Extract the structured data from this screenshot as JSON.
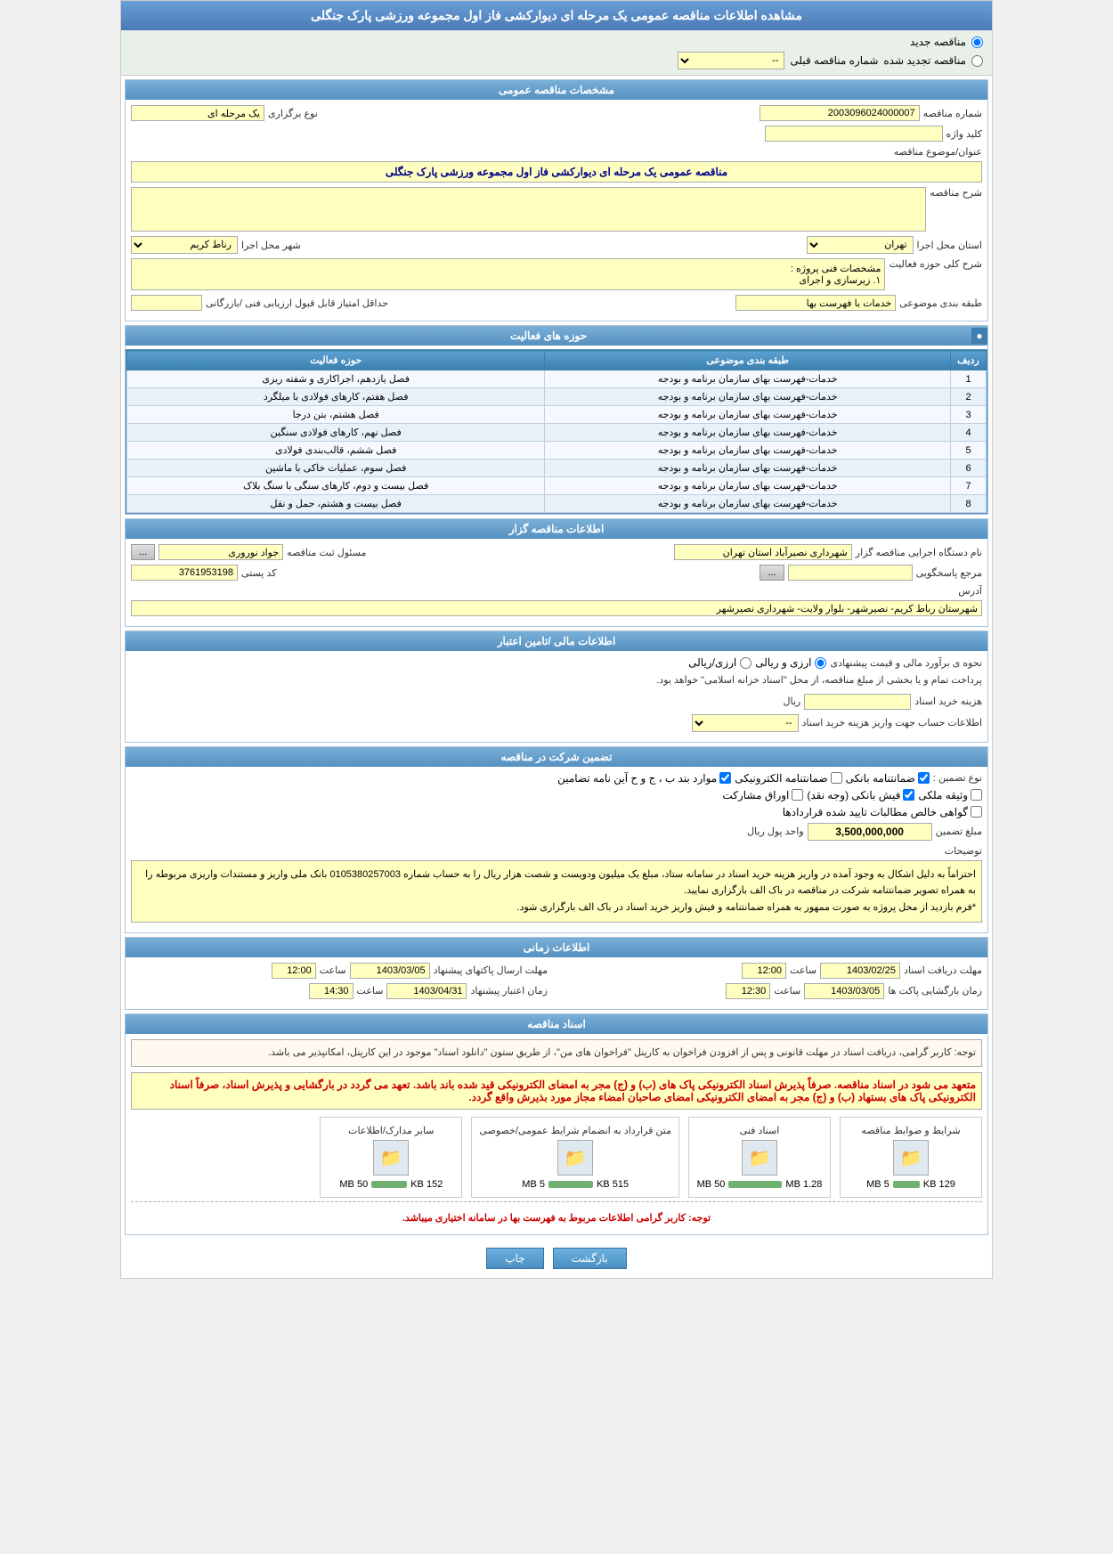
{
  "page": {
    "title": "مشاهده اطلاعات مناقصه عمومی یک مرحله ای دیوارکشی فاز اول مجموعه ورزشی پارک جنگلی"
  },
  "radio": {
    "new_tender": "مناقصه جدید",
    "renewed_tender": "مناقصه تجدید شده",
    "prev_number_label": "شماره مناقصه قبلی"
  },
  "general_specs": {
    "section_title": "مشخصات مناقصه عمومی",
    "tender_number_label": "شماره مناقصه",
    "tender_number_value": "2003096024000007",
    "holding_type_label": "نوع برگزاری",
    "holding_type_value": "یک مرحله ای",
    "keyword_label": "کلید واژه",
    "subject_label": "عنوان/موضوع مناقصه",
    "subject_value": "مناقصه عمومی یک مرحله ای دیوارکشی فاز اول مجموعه ورزشی پارک جنگلی",
    "description_label": "شرح مناقصه",
    "province_label": "استان محل اجرا",
    "province_value": "تهران",
    "city_label": "شهر محل اجرا",
    "city_value": "رناط کریم",
    "activity_scope_label": "شرح کلی حوزه فعالیت",
    "activity_scope_note": "مشخصات فنی پروژه :",
    "activity_scope_sub": "۱.  زیرسازی و اجرای",
    "category_label": "طبقه بندی موضوعی",
    "category_value": "خدمات با فهرست بها",
    "min_score_label": "حداقل امتیاز قابل قبول ارزیابی فنی /بازرگانی"
  },
  "activity_table": {
    "section_title": "حوزه های فعالیت",
    "expand_btn": "●",
    "headers": [
      "ردیف",
      "طبقه بندی موضوعی",
      "حوزه فعالیت"
    ],
    "rows": [
      {
        "row": "1",
        "category": "خدمات-فهرست بهای سازمان برنامه و بودجه",
        "activity": "فصل یازدهم، اجراکاری و شفته ریزی"
      },
      {
        "row": "2",
        "category": "خدمات-فهرست بهای سازمان برنامه و بودجه",
        "activity": "فصل هفتم، کارهای فولادی با میلگرد"
      },
      {
        "row": "3",
        "category": "خدمات-فهرست بهای سازمان برنامه و بودجه",
        "activity": "فصل هشتم، بتن درجا"
      },
      {
        "row": "4",
        "category": "خدمات-فهرست بهای سازمان برنامه و بودجه",
        "activity": "فصل نهم، کارهای فولادی سنگین"
      },
      {
        "row": "5",
        "category": "خدمات-فهرست بهای سازمان برنامه و بودجه",
        "activity": "فصل ششم، قالب‌بندی فولادی"
      },
      {
        "row": "6",
        "category": "خدمات-فهرست بهای سازمان برنامه و بودجه",
        "activity": "فصل سوم، عملیات خاکی با ماشین"
      },
      {
        "row": "7",
        "category": "خدمات-فهرست بهای سازمان برنامه و بودجه",
        "activity": "فصل بیست و دوم، کارهای سنگی با سنگ بلاک"
      },
      {
        "row": "8",
        "category": "خدمات-فهرست بهای سازمان برنامه و بودجه",
        "activity": "فصل بیست و هشتم، حمل و نقل"
      }
    ]
  },
  "organizer": {
    "section_title": "اطلاعات مناقصه گزار",
    "organizer_label": "نام دستگاه اجرایی مناقصه گزار",
    "organizer_value": "شهرداری نصیرآباد استان تهران",
    "contact_label": "مسئول ثبت مناقصه",
    "contact_value": "جواد نوروری",
    "contact_btn": "...",
    "ref_label": "مرجع پاسخگویی",
    "ref_btn": "...",
    "postal_label": "کد پستی",
    "postal_value": "3761953198",
    "address_label": "آدرس",
    "address_value": "شهرستان رباط کریم- نصیرشهر- بلوار ولایت- شهرداری نصیرشهر"
  },
  "financial": {
    "section_title": "اطلاعات مالی /تامین اعتبار",
    "estimate_label": "نحوه ی برآورد مالی و قیمت پیشنهادی",
    "estimate_value": "ارزی و ریالی",
    "payment_note": "پرداخت تمام و یا بخشی از مبلغ مناقصه، از محل \"اسناد خزانه اسلامی\" خواهد بود.",
    "doc_fee_label": "هزینه خرید اسناد",
    "doc_fee_unit": "ریال",
    "bank_info_label": "اطلاعات حساب جهت واریز هزینه خرید اسناد",
    "bank_info_value": "--"
  },
  "guarantee": {
    "section_title": "تضمین شرکت در مناقصه",
    "type_label": "نوع تضمین :",
    "bank_guarantee": "ضمانتنامه بانکی",
    "electronic_guarantee": "ضمانتنامه الکترونیکی",
    "bond_label": "موارد بند ب ، ج و ح آین نامه تضامین",
    "insurance_label": "وثیقه ملکی",
    "bank_check": "فیش بانکی (وجه نقد)",
    "shares": "اوراق مشارکت",
    "court_approved": "گواهی خالص مطالبات تایید شده قراردادها",
    "amount_label": "مبلغ تضمین",
    "amount_value": "3,500,000,000",
    "amount_unit": "واحد پول ریال",
    "description_label": "توضیحات",
    "description_value": "احتراماً به دلیل اشکال به وجود آمده در واریز هزینه خرید اسناد در سامانه ستاد، مبلغ یک میلیون ودویست و شصت هزار ریال را به حساب شماره 0105380257003 بانک ملی واریز و مستندات واریزی مربوطه را به همراه تصویر ضمانتنامه شرکت در مناقصه در باک الف بارگزاری نمایید.\n*فرم بازدید از محل پروژه به صورت ممهور به همراه ضمانتنامه و فیش واریز خرید اسناد در باک الف بارگزاری شود."
  },
  "timing": {
    "section_title": "اطلاعات زمانی",
    "receive_doc_label": "مهلت دریافت اسناد",
    "receive_doc_date": "1403/02/25",
    "receive_doc_time": "12:00",
    "receive_doc_time_label": "ساعت",
    "send_offer_label": "مهلت ارسال پاکتهای پیشنهاد",
    "send_offer_date": "1403/03/05",
    "send_offer_time": "12:00",
    "send_offer_time_label": "ساعت",
    "open_envelopes_label": "زمان بارگشایی پاکت ها",
    "open_envelopes_date": "1403/03/05",
    "open_envelopes_time": "12:30",
    "open_envelopes_time_label": "ساعت",
    "validity_label": "زمان اعتبار پیشنهاد",
    "validity_date": "1403/04/31",
    "validity_time": "14:30",
    "validity_time_label": "ساعت"
  },
  "documents": {
    "section_title": "اسناد مناقصه",
    "notice_text": "توجه: کاربر گرامی، دریافت اسناد در مهلت قانونی و پس از افزودن فراخوان به کارپنل \"فراخوان های من\"، از طریق ستون \"دانلود اسناد\" موجود در این کارپنل، امکانپذیر می باشد.",
    "notice_bold": "متعهد می شود در اسناد مناقصه. صرفاً پذیرش اسناد الکترونیکی پاک های (ب) و (ج) مجر به امضای الکترونیکی قید شده باند باشد. تعهد می گردد در بارگشایی و پذیرش اسناد، صرفاً اسناد الکترونیکی پاک های بستهاد (ب) و (ج) مجر به امضای الکترونیکی امضای صاحبان امضاء مجاز مورد بذیرش واقع گردد.",
    "doc1_label": "شرایط و ضوابط مناقصه",
    "doc1_size": "129 KB",
    "doc1_max": "5 MB",
    "doc2_label": "اسناد فنی",
    "doc2_size": "1.28 MB",
    "doc2_max": "50 MB",
    "doc3_label": "متن قرارداد به انضمام شرایط عمومی/خصوصی",
    "doc3_size": "515 KB",
    "doc3_max": "5 MB",
    "doc4_label": "سایر مدارک/اطلاعات",
    "doc4_size": "152 KB",
    "doc4_max": "50 MB",
    "footer_note": "توجه: کاربر گرامی اطلاعات مربوط به فهرست بها در سامانه اختیاری میباشد."
  },
  "buttons": {
    "print": "چاپ",
    "back": "بازگشت"
  }
}
